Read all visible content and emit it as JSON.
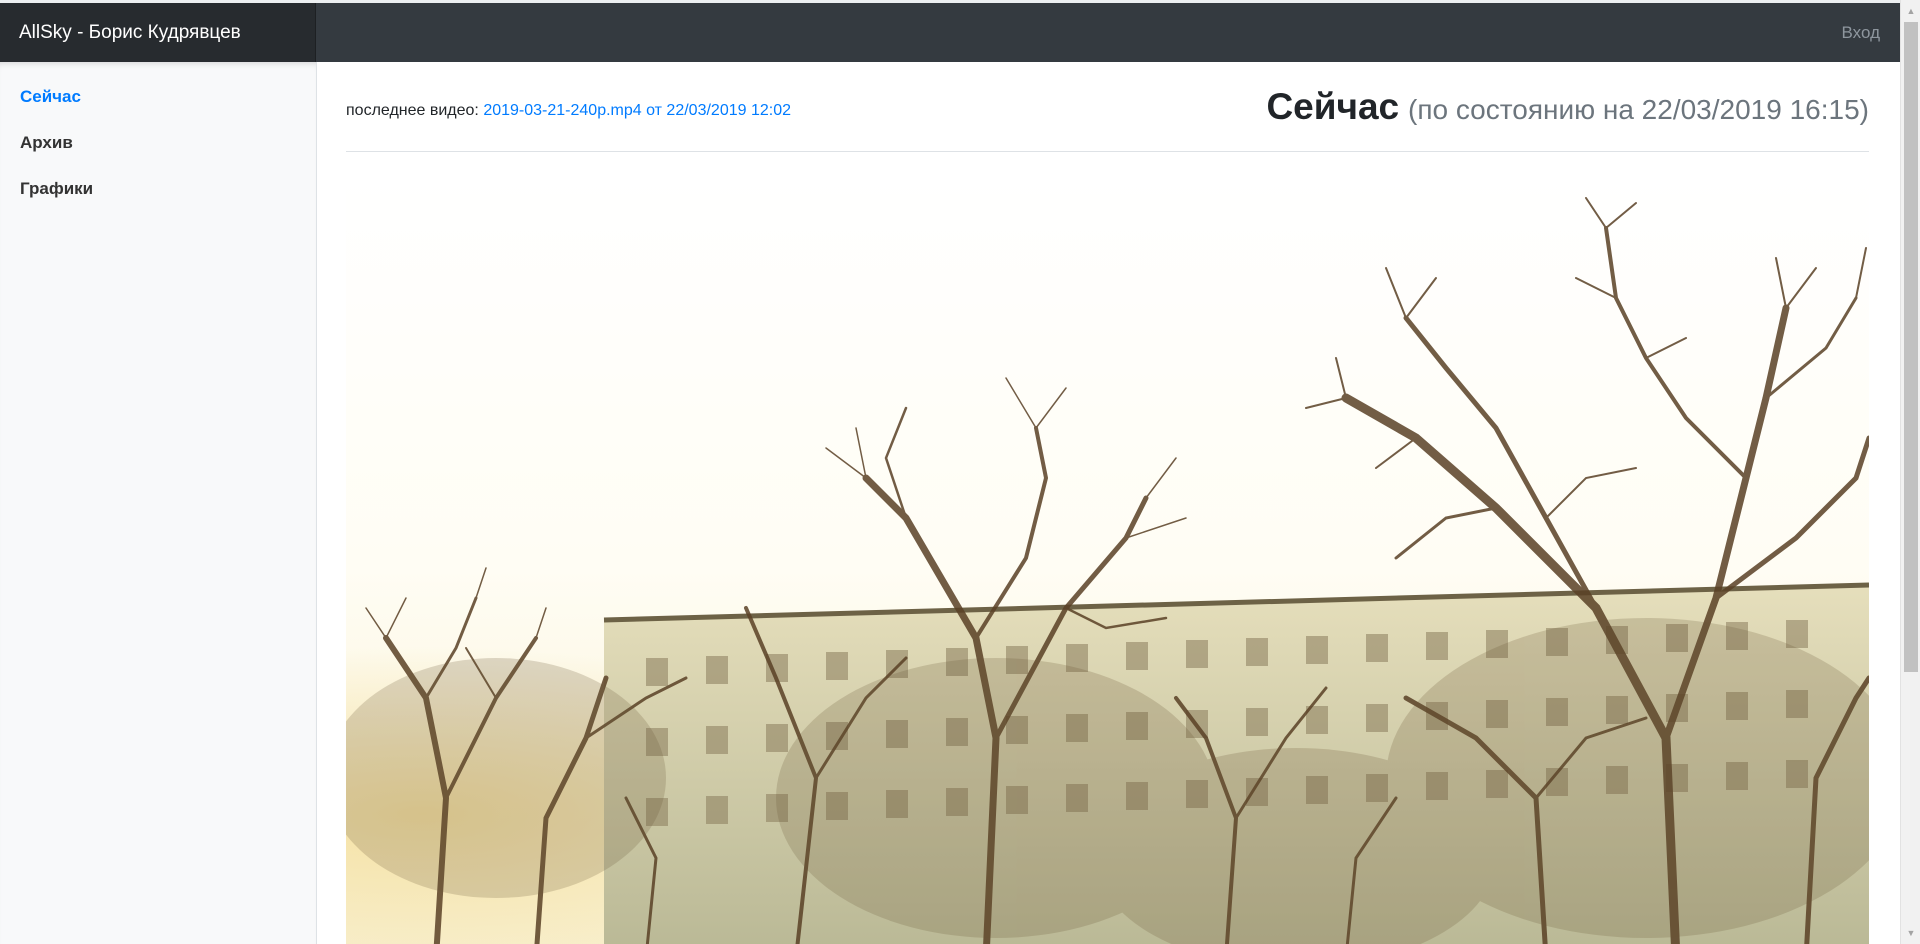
{
  "topbar": {
    "brand": "AllSky - Борис Кудрявцев",
    "login": "Вход"
  },
  "sidebar": {
    "items": [
      {
        "label": "Сейчас",
        "active": true
      },
      {
        "label": "Архив",
        "active": false
      },
      {
        "label": "Графики",
        "active": false
      }
    ]
  },
  "main": {
    "last_video_label": "последнее видео:",
    "last_video_link": "2019-03-21-240p.mp4 от 22/03/2019 12:02",
    "title": "Сейчас",
    "title_sub": "(по состоянию на 22/03/2019 16:15)"
  },
  "image": {
    "description_colors": {
      "sky": "#fffdf2",
      "branches": "#5a4126",
      "building": "#d8d3b2"
    }
  },
  "colors": {
    "navbar": "#343a40",
    "brand_bg": "#272b2f",
    "accent": "#007bff",
    "sidebar_bg": "#f8f9fa"
  }
}
